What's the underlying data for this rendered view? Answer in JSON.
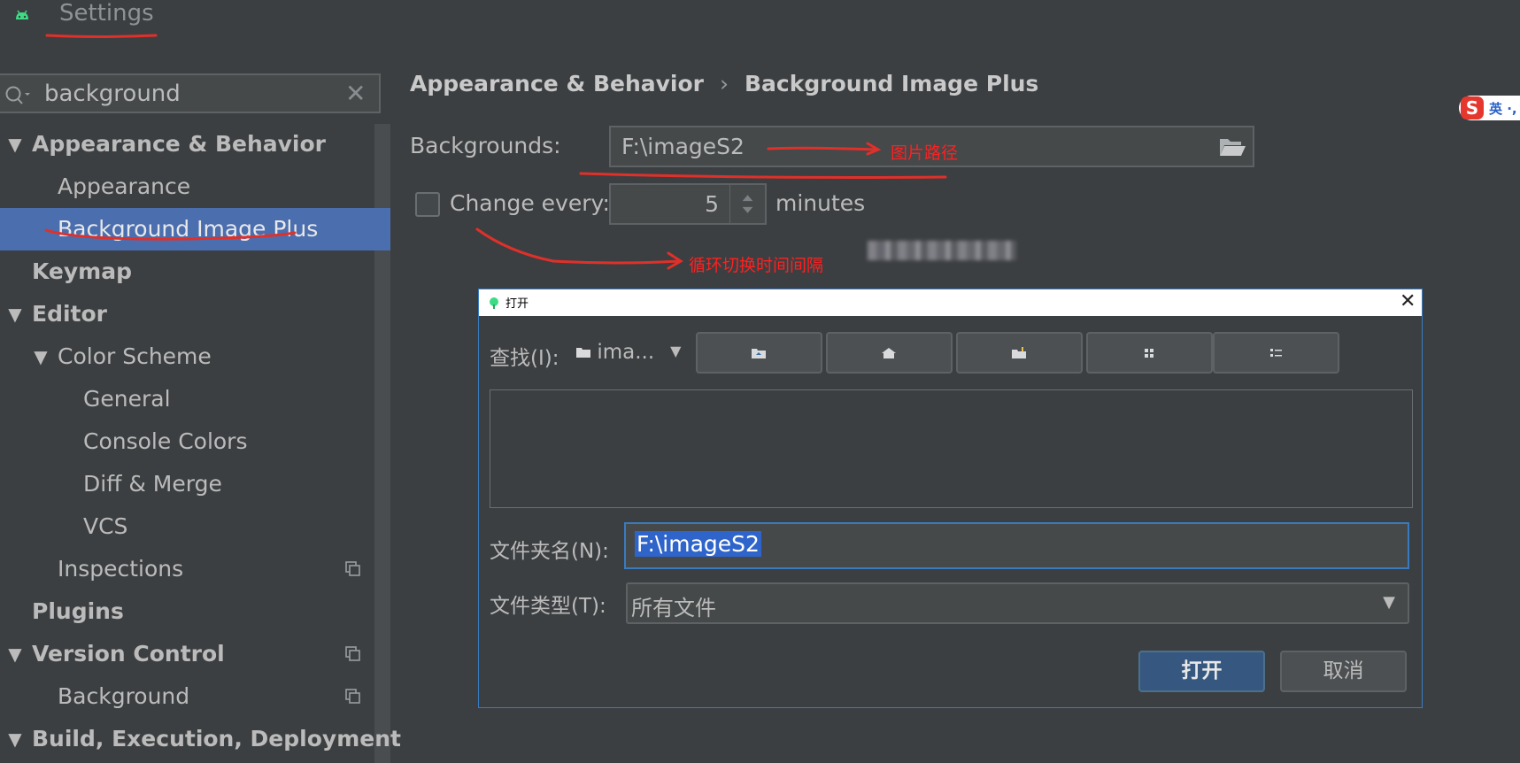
{
  "window": {
    "title": "Settings"
  },
  "search": {
    "value": "background",
    "clear_label": "✕"
  },
  "sidebar": {
    "items": [
      {
        "label": "Appearance & Behavior",
        "indent": 0,
        "bold": true,
        "expanded": true
      },
      {
        "label": "Appearance",
        "indent": 1,
        "bold": false
      },
      {
        "label": "Background Image Plus",
        "indent": 1,
        "bold": false,
        "selected": true
      },
      {
        "label": "Keymap",
        "indent": 0,
        "bold": true
      },
      {
        "label": "Editor",
        "indent": 0,
        "bold": true,
        "expanded": true
      },
      {
        "label": "Color Scheme",
        "indent": 1,
        "bold": false,
        "expanded": true
      },
      {
        "label": "General",
        "indent": 2,
        "bold": false
      },
      {
        "label": "Console Colors",
        "indent": 2,
        "bold": false
      },
      {
        "label": "Diff & Merge",
        "indent": 2,
        "bold": false
      },
      {
        "label": "VCS",
        "indent": 2,
        "bold": false
      },
      {
        "label": "Inspections",
        "indent": 1,
        "bold": false,
        "copy_icon": true
      },
      {
        "label": "Plugins",
        "indent": 0,
        "bold": true
      },
      {
        "label": "Version Control",
        "indent": 0,
        "bold": true,
        "expanded": true,
        "copy_icon": true
      },
      {
        "label": "Background",
        "indent": 1,
        "bold": false,
        "copy_icon": true
      },
      {
        "label": "Build, Execution, Deployment",
        "indent": 0,
        "bold": true,
        "expanded": true
      }
    ]
  },
  "breadcrumb": {
    "parent": "Appearance & Behavior",
    "separator": "›",
    "current": "Background Image Plus"
  },
  "form": {
    "backgrounds_label": "Backgrounds:",
    "backgrounds_value": "F:\\imageS2",
    "change_every_label": "Change every:",
    "change_every_value": "5",
    "minutes_label": "minutes"
  },
  "annotations": {
    "image_path": "图片路径",
    "interval": "循环切换时间间隔"
  },
  "ime": {
    "logo": "S",
    "text": "英 ·,"
  },
  "dialog": {
    "title": "打开",
    "close_label": "✕",
    "lookin_label": "查找(I):",
    "lookin_value": "ima...",
    "toolbar": [
      "up-folder-icon",
      "home-icon",
      "new-folder-icon",
      "list-view-icon",
      "details-view-icon"
    ],
    "folder_name_label": "文件夹名(N):",
    "folder_name_value": "F:\\imageS2",
    "file_type_label": "文件类型(T):",
    "file_type_value": "所有文件",
    "open_button": "打开",
    "cancel_button": "取消"
  },
  "colors": {
    "background": "#3c3f41",
    "selection": "#4b6eaf",
    "annotation": "#ff2020",
    "primary_button": "#365880"
  }
}
